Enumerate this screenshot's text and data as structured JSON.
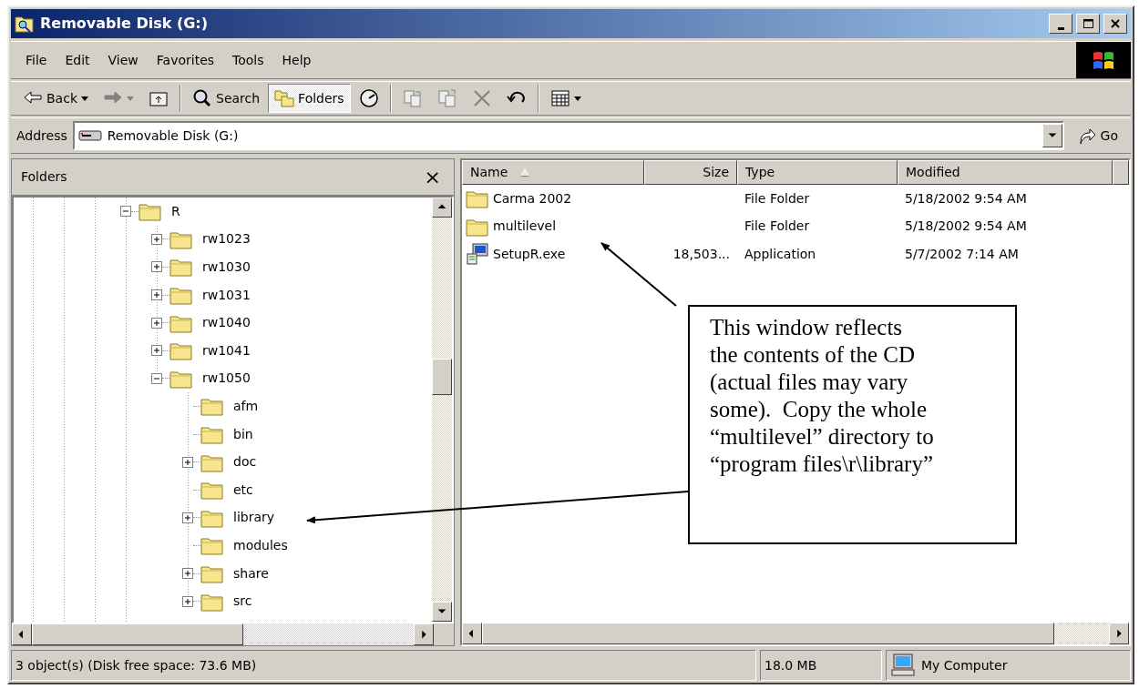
{
  "window": {
    "title": "Removable Disk (G:)"
  },
  "menu": [
    "File",
    "Edit",
    "View",
    "Favorites",
    "Tools",
    "Help"
  ],
  "toolbar": {
    "groups": [
      [
        {
          "kind": "back",
          "label": "Back",
          "menu": true,
          "disabled": false,
          "selected": false
        },
        {
          "kind": "forward",
          "menu": true,
          "disabled": true,
          "selected": false
        },
        {
          "kind": "up",
          "menu": false,
          "disabled": false,
          "selected": false
        }
      ],
      [
        {
          "kind": "search",
          "label": "Search",
          "menu": false,
          "disabled": false,
          "selected": false
        },
        {
          "kind": "folders",
          "label": "Folders",
          "menu": false,
          "disabled": false,
          "selected": true
        },
        {
          "kind": "history",
          "menu": false,
          "disabled": false,
          "selected": false
        }
      ],
      [
        {
          "kind": "moveto",
          "menu": false,
          "disabled": true,
          "selected": false
        },
        {
          "kind": "copyto",
          "menu": false,
          "disabled": true,
          "selected": false
        },
        {
          "kind": "delete",
          "menu": false,
          "disabled": true,
          "selected": false
        },
        {
          "kind": "undo",
          "menu": false,
          "disabled": false,
          "selected": false
        }
      ],
      [
        {
          "kind": "views",
          "menu": true,
          "disabled": false,
          "selected": false
        }
      ]
    ]
  },
  "address": {
    "label": "Address",
    "value": "Removable Disk (G:)",
    "go": "Go"
  },
  "folders_pane": {
    "title": "Folders",
    "close": "×",
    "tree": [
      {
        "label": "R",
        "expandable": true,
        "expanded": true,
        "children": [
          {
            "label": "rw1023",
            "expandable": true,
            "expanded": false
          },
          {
            "label": "rw1030",
            "expandable": true,
            "expanded": false
          },
          {
            "label": "rw1031",
            "expandable": true,
            "expanded": false
          },
          {
            "label": "rw1040",
            "expandable": true,
            "expanded": false
          },
          {
            "label": "rw1041",
            "expandable": true,
            "expanded": false
          },
          {
            "label": "rw1050",
            "expandable": true,
            "expanded": true,
            "children": [
              {
                "label": "afm",
                "expandable": false
              },
              {
                "label": "bin",
                "expandable": false
              },
              {
                "label": "doc",
                "expandable": true,
                "expanded": false
              },
              {
                "label": "etc",
                "expandable": false
              },
              {
                "label": "library",
                "expandable": true,
                "expanded": false
              },
              {
                "label": "modules",
                "expandable": false
              },
              {
                "label": "share",
                "expandable": true,
                "expanded": false
              },
              {
                "label": "src",
                "expandable": true,
                "expanded": false
              }
            ]
          }
        ]
      }
    ]
  },
  "file_list": {
    "columns": [
      {
        "label": "Name",
        "sorted": true
      },
      {
        "label": "Size",
        "sorted": false
      },
      {
        "label": "Type",
        "sorted": false
      },
      {
        "label": "Modified",
        "sorted": false
      }
    ],
    "rows": [
      {
        "kind": "folder",
        "name": "Carma 2002",
        "size": "",
        "type": "File Folder",
        "modified": "5/18/2002 9:54 AM"
      },
      {
        "kind": "folder",
        "name": "multilevel",
        "size": "",
        "type": "File Folder",
        "modified": "5/18/2002 9:54 AM"
      },
      {
        "kind": "application",
        "name": "SetupR.exe",
        "size": "18,503...",
        "type": "Application",
        "modified": "5/7/2002 7:14 AM"
      }
    ]
  },
  "callout": {
    "text": "This window reflects\nthe contents of the CD\n(actual files may vary\nsome).  Copy the whole\n“multilevel” directory to\n“program files\\r\\library”"
  },
  "status_bar": {
    "text": "3 object(s) (Disk free space: 73.6 MB)",
    "size": "18.0 MB",
    "zone": "My Computer"
  }
}
